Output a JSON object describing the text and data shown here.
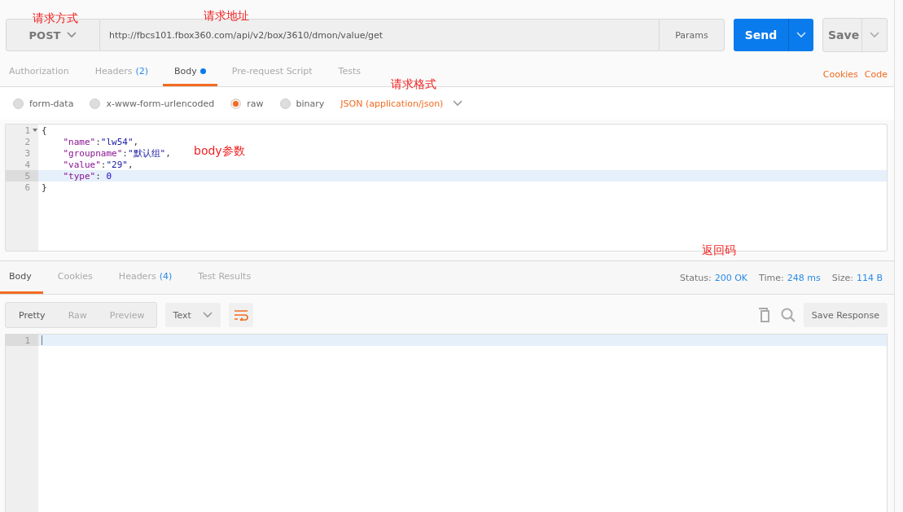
{
  "request": {
    "method": "POST",
    "url": "http://fbcs101.fbox360.com/api/v2/box/3610/dmon/value/get",
    "params_label": "Params",
    "send_label": "Send",
    "save_label": "Save"
  },
  "request_tabs": [
    {
      "label": "Authorization",
      "selected": false
    },
    {
      "label": "Headers",
      "count": "(2)",
      "selected": false
    },
    {
      "label": "Body",
      "selected": true,
      "dot": true
    },
    {
      "label": "Pre-request Script",
      "selected": false
    },
    {
      "label": "Tests",
      "selected": false
    }
  ],
  "request_links": [
    "Cookies",
    "Code"
  ],
  "body_modes": [
    {
      "label": "form-data",
      "selected": false
    },
    {
      "label": "x-www-form-urlencoded",
      "selected": false
    },
    {
      "label": "raw",
      "selected": true
    },
    {
      "label": "binary",
      "selected": false
    }
  ],
  "raw_format": "JSON (application/json)",
  "body_editor": {
    "lines": [
      {
        "number": "1",
        "foldable": true,
        "active": false,
        "tokens": [
          {
            "kind": "punct",
            "text": "{"
          }
        ]
      },
      {
        "number": "2",
        "foldable": false,
        "active": false,
        "tokens": [
          {
            "kind": "key",
            "text": "    \"name\""
          },
          {
            "kind": "punct",
            "text": ":"
          },
          {
            "kind": "string",
            "text": "\"lw54\""
          },
          {
            "kind": "punct",
            "text": ","
          }
        ]
      },
      {
        "number": "3",
        "foldable": false,
        "active": false,
        "tokens": [
          {
            "kind": "key",
            "text": "    \"groupname\""
          },
          {
            "kind": "punct",
            "text": ":"
          },
          {
            "kind": "string",
            "text": "\"默认组\""
          },
          {
            "kind": "punct",
            "text": ","
          }
        ]
      },
      {
        "number": "4",
        "foldable": false,
        "active": false,
        "tokens": [
          {
            "kind": "key",
            "text": "    \"value\""
          },
          {
            "kind": "punct",
            "text": ":"
          },
          {
            "kind": "string",
            "text": "\"29\""
          },
          {
            "kind": "punct",
            "text": ","
          }
        ]
      },
      {
        "number": "5",
        "foldable": false,
        "active": true,
        "tokens": [
          {
            "kind": "key",
            "text": "    \"type\""
          },
          {
            "kind": "punct",
            "text": ": "
          },
          {
            "kind": "number",
            "text": "0"
          }
        ]
      },
      {
        "number": "6",
        "foldable": false,
        "active": false,
        "tokens": [
          {
            "kind": "punct",
            "text": "}"
          }
        ]
      }
    ]
  },
  "response_tabs": [
    {
      "label": "Body",
      "selected": true
    },
    {
      "label": "Cookies",
      "selected": false
    },
    {
      "label": "Headers",
      "count": "(4)",
      "selected": false
    },
    {
      "label": "Test Results",
      "selected": false
    }
  ],
  "response_meta": [
    {
      "label": "Status:",
      "value": "200 OK"
    },
    {
      "label": "Time:",
      "value": "248 ms"
    },
    {
      "label": "Size:",
      "value": "114 B"
    }
  ],
  "view_modes": [
    {
      "label": "Pretty",
      "selected": true
    },
    {
      "label": "Raw",
      "selected": false
    },
    {
      "label": "Preview",
      "selected": false
    }
  ],
  "response_format": "Text",
  "wrap_on": true,
  "save_response_label": "Save Response",
  "response_editor": {
    "lines": [
      {
        "number": "1",
        "active": true
      }
    ]
  },
  "annotations": {
    "method": "请求方式",
    "url": "请求地址",
    "format": "请求格式",
    "body": "body参数",
    "status": "返回码"
  }
}
